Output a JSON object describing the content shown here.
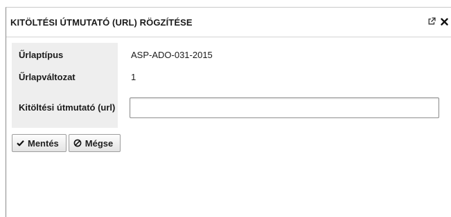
{
  "dialog": {
    "title": "KITÖLTÉSI ÚTMUTATÓ (URL) RÖGZÍTÉSE",
    "icons": [
      "external-link-icon",
      "close-icon"
    ]
  },
  "form": {
    "rows": [
      {
        "label": "Űrlaptípus",
        "value": "ASP-ADO-031-2015"
      },
      {
        "label": "Űrlapváltozat",
        "value": "1"
      },
      {
        "label": "Kitöltési útmutató (url)",
        "value": "",
        "placeholder": ""
      }
    ]
  },
  "buttons": {
    "save_label": "Mentés",
    "save_icon": "check-icon",
    "cancel_label": "Mégse",
    "cancel_icon": "ban-icon"
  }
}
